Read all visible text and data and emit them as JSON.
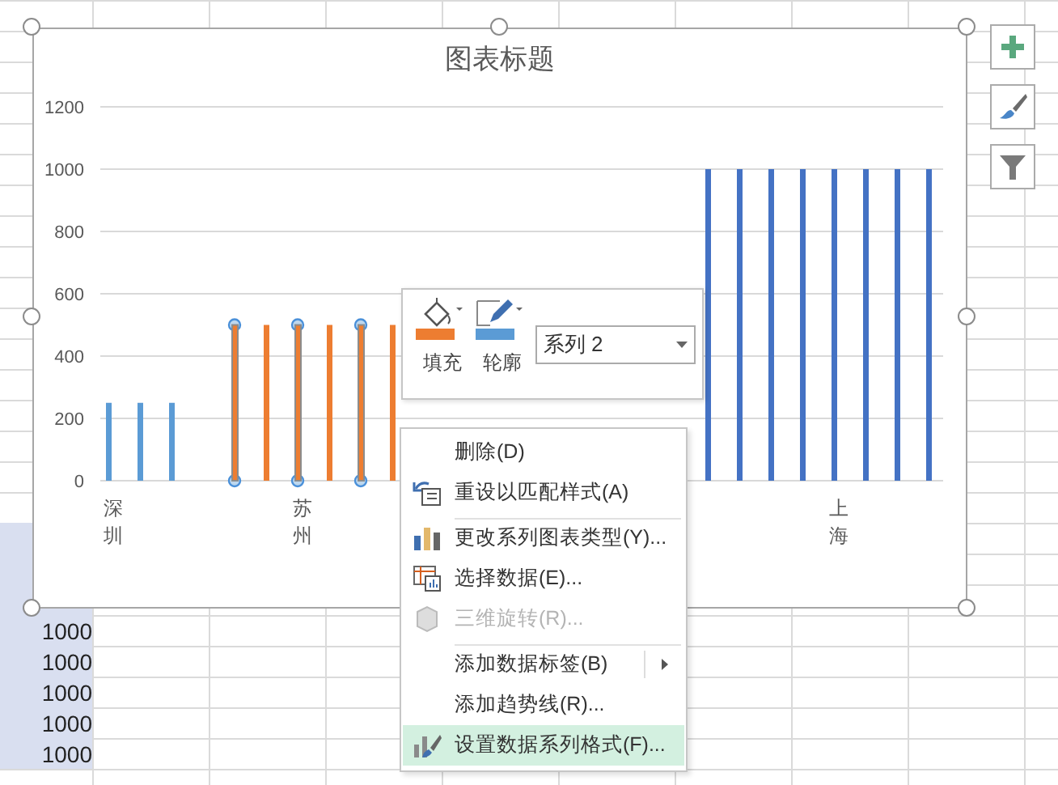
{
  "sheet": {
    "cells": [
      "1000",
      "1000",
      "1000",
      "1000",
      "1000"
    ]
  },
  "chart": {
    "title": "图表标题",
    "series_states": [
      {
        "selected": false
      },
      {
        "selected": true
      },
      {
        "selected": false
      }
    ],
    "chart_data": {
      "type": "bar",
      "ylim": [
        0,
        1200
      ],
      "grid": true,
      "categories": [
        "深圳",
        null,
        null,
        null,
        null,
        null,
        "苏州",
        null,
        null,
        null,
        null,
        null,
        null,
        null,
        null,
        null,
        null,
        null,
        null,
        null,
        null,
        null,
        null,
        "上海",
        null,
        null,
        null
      ],
      "yticks": [
        0,
        200,
        400,
        600,
        800,
        1000,
        1200
      ],
      "series": [
        {
          "color": "#5b9bd5",
          "values": [
            250,
            250,
            250,
            null,
            null,
            null,
            null,
            null,
            null,
            null,
            null,
            null,
            null,
            null,
            null,
            null,
            null,
            null,
            null,
            null,
            null,
            null,
            null,
            null,
            null,
            null,
            null
          ]
        },
        {
          "name": "系列 2",
          "color": "#ed7d31",
          "values": [
            null,
            null,
            null,
            null,
            500,
            500,
            500,
            500,
            500,
            500,
            null,
            null,
            null,
            null,
            null,
            null,
            null,
            null,
            null,
            null,
            null,
            null,
            null,
            null,
            null,
            null,
            null
          ]
        },
        {
          "color": "#4472c4",
          "values": [
            null,
            null,
            null,
            null,
            null,
            null,
            null,
            null,
            null,
            null,
            null,
            null,
            null,
            null,
            null,
            null,
            null,
            null,
            null,
            1000,
            1000,
            1000,
            1000,
            1000,
            1000,
            1000,
            1000
          ]
        }
      ]
    }
  },
  "mini_toolbar": {
    "buttons": [
      {
        "label": "填充"
      },
      {
        "label": "轮廓"
      }
    ]
  },
  "context_menu": {
    "items": [
      {
        "label": "删除(D)",
        "disabled": false,
        "highlighted": false,
        "submenu": false,
        "separator_before": false
      },
      {
        "label": "重设以匹配样式(A)",
        "disabled": false,
        "highlighted": false,
        "submenu": false,
        "separator_before": false
      },
      {
        "label": "更改系列图表类型(Y)...",
        "disabled": false,
        "highlighted": false,
        "submenu": false,
        "separator_before": true
      },
      {
        "label": "选择数据(E)...",
        "disabled": false,
        "highlighted": false,
        "submenu": false,
        "separator_before": false
      },
      {
        "label": "三维旋转(R)...",
        "disabled": true,
        "highlighted": false,
        "submenu": false,
        "separator_before": false
      },
      {
        "label": "添加数据标签(B)",
        "disabled": false,
        "highlighted": false,
        "submenu": true,
        "separator_before": true
      },
      {
        "label": "添加趋势线(R)...",
        "disabled": false,
        "highlighted": false,
        "submenu": false,
        "separator_before": false
      },
      {
        "label": "设置数据系列格式(F)...",
        "disabled": false,
        "highlighted": true,
        "submenu": false,
        "separator_before": false
      }
    ]
  }
}
